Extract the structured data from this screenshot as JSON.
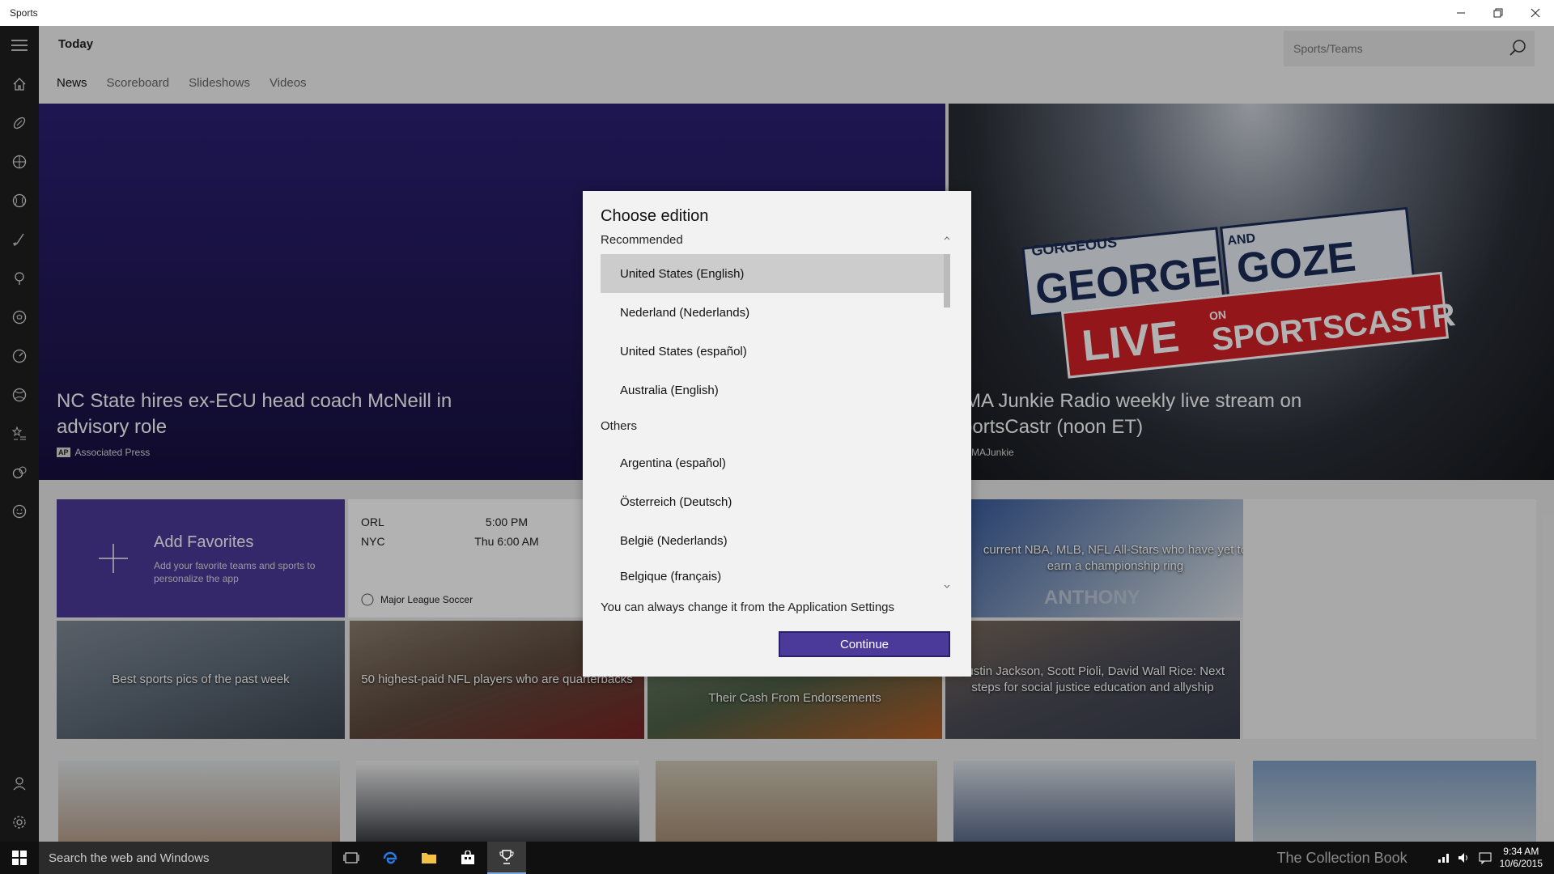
{
  "window": {
    "title": "Sports"
  },
  "header": {
    "section_title": "Today",
    "search_placeholder": "Sports/Teams"
  },
  "tabs": [
    {
      "label": "News"
    },
    {
      "label": "Scoreboard"
    },
    {
      "label": "Slideshows"
    },
    {
      "label": "Videos"
    }
  ],
  "hero": [
    {
      "title_line1": "NC State hires ex-ECU head coach McNeill in",
      "title_line2": "advisory role",
      "source": "Associated Press",
      "logo": "AP"
    },
    {
      "title_line1": "MMA Junkie Radio weekly live stream on",
      "title_line2": "SportsCastr (noon ET)",
      "source": "MMAJunkie",
      "banner_top": "GORGEOUS",
      "banner_l1": "GEORGE",
      "banner_and": "AND",
      "banner_l2": "GOZE",
      "banner_live": "LIVE",
      "banner_on": "ON",
      "banner_brand": "SPORTSCASTR"
    }
  ],
  "favorites": {
    "title": "Add Favorites",
    "subtitle_line1": "Add your favorite teams and sports to",
    "subtitle_line2": "personalize the app"
  },
  "score": {
    "team1": "ORL",
    "time1": "5:00 PM",
    "team2": "NYC",
    "time2": "Thu 6:00 AM",
    "league": "Major League Soccer"
  },
  "tiles": {
    "nba": "current NBA, MLB, NFL All-Stars who have yet to earn a championship ring",
    "jersey": "ANTHONY",
    "pics": "Best sports pics of the past week",
    "nfl": "50 highest-paid NFL players who are quarterbacks",
    "cash": "Their Cash From Endorsements",
    "justice": "Justin Jackson, Scott Pioli, David Wall Rice: Next steps for social justice education and allyship"
  },
  "dialog": {
    "title": "Choose edition",
    "recommended_label": "Recommended",
    "recommended": [
      {
        "label": "United States (English)",
        "selected": true
      },
      {
        "label": "Nederland (Nederlands)",
        "selected": false
      },
      {
        "label": "United States (español)",
        "selected": false
      },
      {
        "label": "Australia (English)",
        "selected": false
      }
    ],
    "others_label": "Others",
    "others": [
      {
        "label": "Argentina (español)"
      },
      {
        "label": "Österreich (Deutsch)"
      },
      {
        "label": "België (Nederlands)"
      },
      {
        "label": "Belgique (français)"
      }
    ],
    "note": "You can always change it from the Application Settings",
    "continue_label": "Continue"
  },
  "taskbar": {
    "search_placeholder": "Search the web and Windows",
    "time": "9:34 AM",
    "date": "10/6/2015",
    "watermark": "The Collection Book"
  },
  "colors": {
    "accent": "#4b3a9a",
    "rail": "#1f1f1f",
    "taskbar": "#101010"
  }
}
